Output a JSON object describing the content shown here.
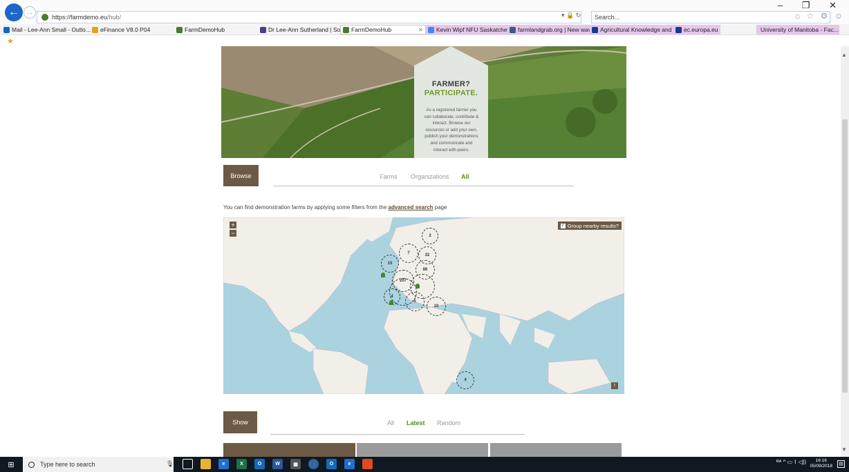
{
  "browser": {
    "url_prefix": "https://",
    "url_host": "farmdemo.eu",
    "url_path": "/hub/",
    "address_icons": "▾ 🔒 ↻",
    "search_placeholder": "Search...",
    "search_icon_text": "⌕ ▾",
    "window_controls": "– ❐ ✕",
    "tool_icons": "⌂ ☆ ⚙ ☺"
  },
  "favorites": [
    {
      "label": "Mail - Lee-Ann Small - Outlo...",
      "color": "#0f6cbd"
    },
    {
      "label": "eFinance V8.0 P04",
      "color": "#e6a21f"
    },
    {
      "label": "FarmDemoHub",
      "color": "#4a7b2c"
    },
    {
      "label": "Dr Lee-Ann Sutherland | Soci...",
      "color": "#4b3f86"
    },
    {
      "label": "FarmDemoHub",
      "color": "#4a7b2c"
    },
    {
      "label": "Kevin Wipf NFU Saskatchewa...",
      "color": "#4285f4"
    },
    {
      "label": "farmlandgrab.org | New wav...",
      "color": "#3d5a80"
    },
    {
      "label": "Agricultural Knowledge and ...",
      "color": "#1a3a8f"
    },
    {
      "label": "ec.europa.eu",
      "color": "#1a3a8f"
    },
    {
      "label": "University of Manitoba - Fac...",
      "color": "#7a3e1d"
    }
  ],
  "hero": {
    "title": "FARMER?",
    "subtitle": "PARTICIPATE.",
    "text": "As a registered farmer you can collaborate, contribute & interact. Browse our resources or add your own, publish your demonstrations and communicate and interact with peers."
  },
  "browse": {
    "button": "Browse",
    "tabs": [
      "Farms",
      "Organizations",
      "All"
    ]
  },
  "info": {
    "before": "You can find demonstration farms by applying some filters from the ",
    "link": "advanced search",
    "after": " page"
  },
  "map": {
    "zoom_in": "+",
    "zoom_out": "−",
    "group_label": "Group nearby results?",
    "group_checked": true,
    "info_button": "i",
    "clusters": [
      "2",
      "7",
      "32",
      "15",
      "86",
      "207",
      "4",
      "5",
      "10",
      "4"
    ]
  },
  "show": {
    "button": "Show",
    "tabs": [
      "All",
      "Latest",
      "Random"
    ]
  },
  "taskbar": {
    "search_placeholder": "Type here to search",
    "time": "16:16",
    "date": "05/09/2018",
    "tray": "ᴿᴬ ^ ▭ ⌇ ◁))"
  },
  "colors": {
    "brand_brown": "#6c5a46",
    "brand_green": "#5c8a1e",
    "map_water": "#aad3df"
  }
}
